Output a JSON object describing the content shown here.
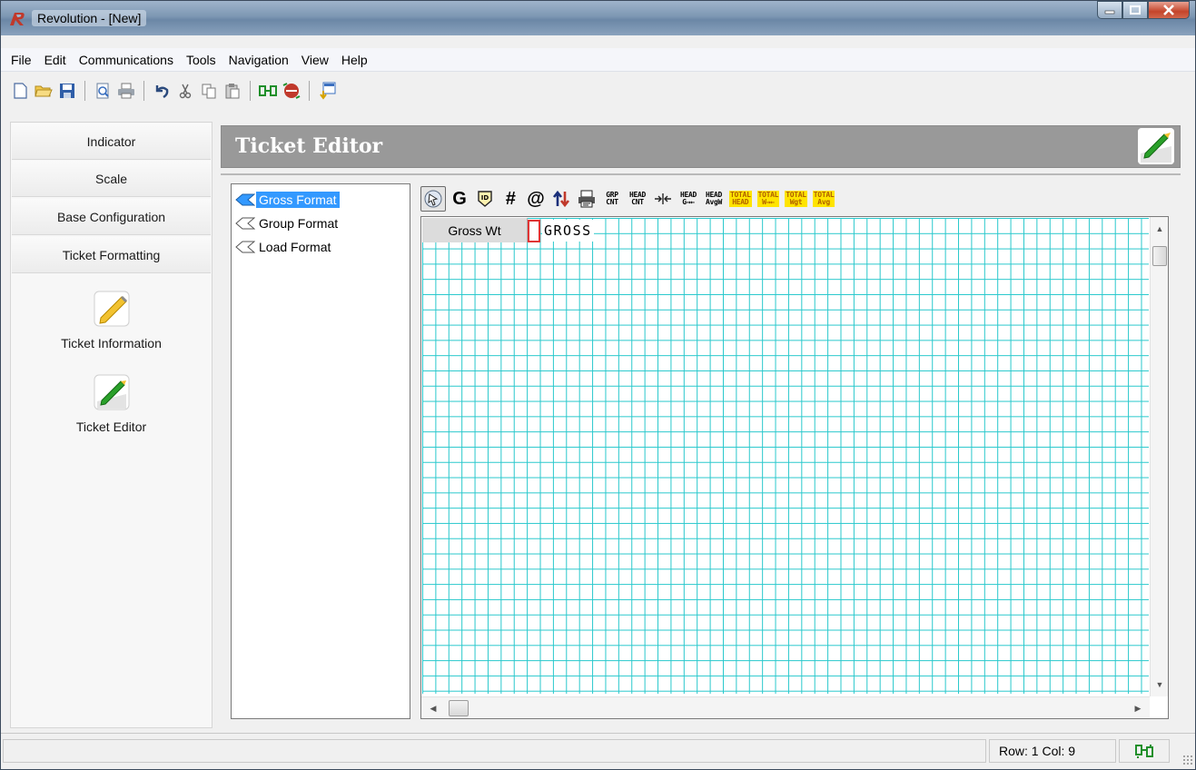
{
  "window": {
    "title": "Revolution - [New]",
    "buttons": [
      "minimize",
      "maximize",
      "close"
    ]
  },
  "menu": [
    "File",
    "Edit",
    "Communications",
    "Tools",
    "Navigation",
    "View",
    "Help"
  ],
  "toolbar": {
    "icons": [
      "new-icon",
      "open-icon",
      "save-icon",
      "print-preview-icon",
      "print-icon",
      "undo-icon",
      "cut-icon",
      "copy-icon",
      "paste-icon",
      "connect-icon",
      "disconnect-icon",
      "export-icon"
    ]
  },
  "sidebar": {
    "nav": [
      "Indicator",
      "Scale",
      "Base Configuration",
      "Ticket Formatting"
    ],
    "tools": [
      {
        "label": "Ticket Information",
        "icon": "ticket-information-icon"
      },
      {
        "label": "Ticket Editor",
        "icon": "ticket-editor-icon"
      }
    ]
  },
  "header": {
    "title": "Ticket Editor",
    "icon": "ticket-editor-icon"
  },
  "tree": {
    "items": [
      {
        "label": "Gross Format",
        "selected": true
      },
      {
        "label": "Group Format",
        "selected": false
      },
      {
        "label": "Load Format",
        "selected": false
      }
    ]
  },
  "editor_toolbar": {
    "select": "select-tool-icon",
    "gross": "G",
    "id": "ID",
    "number": "#",
    "at": "@",
    "swap": "swap-icon",
    "print": "printer-icon",
    "grp_cnt": [
      "GRP",
      "CNT"
    ],
    "head_cnt": [
      "HEAD",
      "CNT"
    ],
    "spacing": "spacing-icon",
    "head_g": [
      "HEAD",
      "G→←"
    ],
    "head_avgw": [
      "HEAD",
      "AvgW"
    ],
    "total_head": [
      "TOTAL",
      "HEAD"
    ],
    "total_w": [
      "TOTAL",
      "W→←"
    ],
    "total_wgt": [
      "TOTAL",
      "Wgt"
    ],
    "total_avg": [
      "TOTAL",
      "Avg"
    ],
    "highlight_color": "#ffe400"
  },
  "grid": {
    "row_label": "Gross Wt",
    "text": "GROSS",
    "line_color": "#28c8cc",
    "cursor_color": "#e03535"
  },
  "status": {
    "position": "Row: 1 Col: 9",
    "connection_icon": "connection-status-icon"
  }
}
